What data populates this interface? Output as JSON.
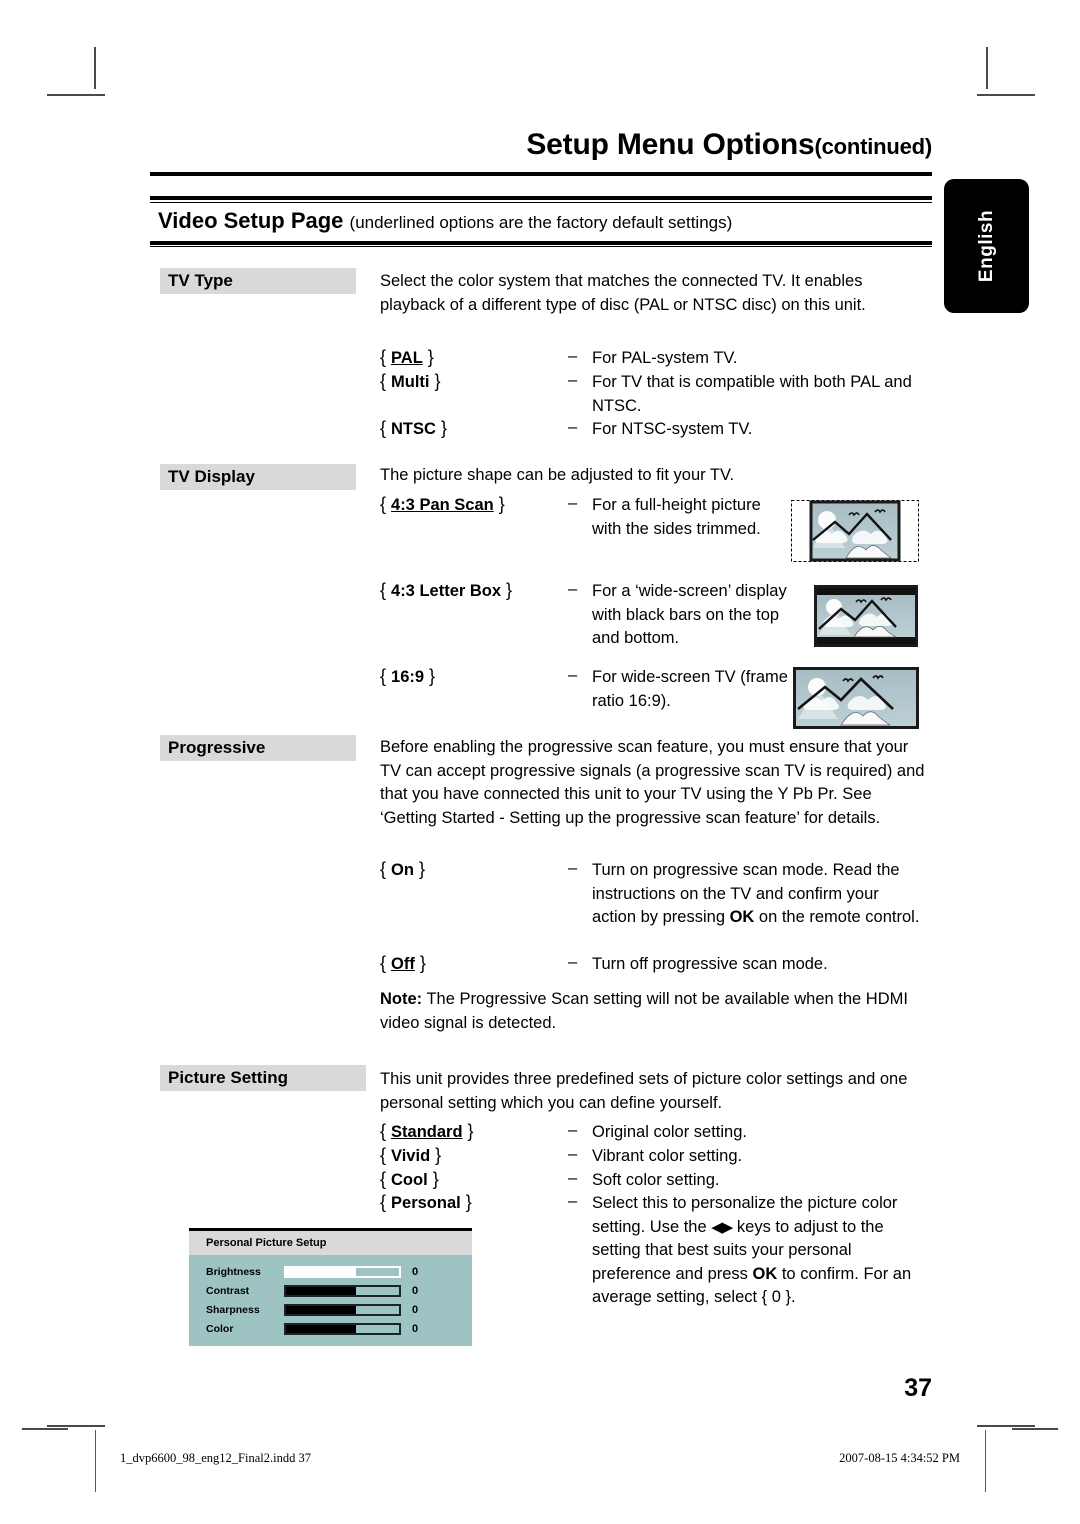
{
  "header": {
    "title": "Setup Menu Options",
    "title_suffix": "(continued)",
    "section_title": "Video Setup Page",
    "section_subtitle": "(underlined options are the factory default settings)",
    "language_tab": "English"
  },
  "sections": [
    {
      "label": "TV Type",
      "intro": "Select the color system that matches the connected TV. It enables playback of a different type of disc (PAL or NTSC disc) on this unit.",
      "options": [
        {
          "name": "PAL",
          "underlined": true,
          "dash": "–",
          "desc": "For PAL-system TV."
        },
        {
          "name": "Multi",
          "underlined": false,
          "dash": "–",
          "desc": "For TV that is compatible with both PAL and NTSC."
        },
        {
          "name": "NTSC",
          "underlined": false,
          "dash": "–",
          "desc": "For NTSC-system TV."
        }
      ]
    },
    {
      "label": "TV Display",
      "intro": "The picture shape can be adjusted to fit your TV.",
      "options": [
        {
          "name": "4:3 Pan Scan",
          "underlined": true,
          "dash": "–",
          "desc": "For a full-height picture with the sides trimmed.",
          "thumb": "pan-scan"
        },
        {
          "name": "4:3 Letter Box",
          "underlined": false,
          "dash": "–",
          "desc": "For a ‘wide-screen’ display with black bars on the top and bottom.",
          "thumb": "letter-box"
        },
        {
          "name": "16:9",
          "underlined": false,
          "dash": "–",
          "desc": "For wide-screen TV (frame ratio 16:9).",
          "thumb": "widescreen"
        }
      ]
    },
    {
      "label": "Progressive",
      "intro": "Before enabling the progressive scan feature, you must ensure that your TV can accept progressive signals (a progressive scan TV is required) and that you have connected this unit to your TV using the Y Pb Pr. See ‘Getting Started - Setting up the progressive scan feature’ for details.",
      "options": [
        {
          "name": "On",
          "underlined": false,
          "dash": "–",
          "desc_pre": "Turn on progressive scan mode. Read the instructions on the TV and confirm your action by pressing ",
          "desc_bold": "OK",
          "desc_post": " on the remote control."
        },
        {
          "name": "Off",
          "underlined": true,
          "dash": "–",
          "desc": "Turn off progressive scan mode."
        }
      ],
      "note_label": "Note:",
      "note_text": " The Progressive Scan setting will not be available when the HDMI video signal is detected."
    },
    {
      "label": "Picture Setting",
      "intro": "This unit provides three predefined sets of picture color settings and one personal setting which you can define yourself.",
      "options": [
        {
          "name": "Standard",
          "underlined": true,
          "dash": "–",
          "desc": "Original color setting."
        },
        {
          "name": "Vivid",
          "underlined": false,
          "dash": "–",
          "desc": "Vibrant color setting."
        },
        {
          "name": "Cool",
          "underlined": false,
          "dash": "–",
          "desc": "Soft color setting."
        },
        {
          "name": "Personal",
          "underlined": false,
          "dash": "–",
          "desc_pre": "Select this to personalize the picture color setting. Use the ",
          "desc_keys": "◀▶",
          "desc_mid": " keys to adjust to the setting that best suits your personal preference and press ",
          "desc_bold": "OK",
          "desc_post": " to confirm. For an average setting, select { 0 }."
        }
      ]
    }
  ],
  "osd": {
    "title": "Personal Picture Setup",
    "rows": [
      {
        "name": "Brightness",
        "value": "0",
        "fill_percent": 62,
        "style": "light"
      },
      {
        "name": "Contrast",
        "value": "0",
        "fill_percent": 62,
        "style": "dark"
      },
      {
        "name": "Sharpness",
        "value": "0",
        "fill_percent": 62,
        "style": "dark"
      },
      {
        "name": "Color",
        "value": "0",
        "fill_percent": 62,
        "style": "dark"
      }
    ],
    "colors": {
      "panel": "#9ec3c3",
      "title_bar": "#d9d9d9"
    }
  },
  "footer": {
    "page_number": "37",
    "file_name": "1_dvp6600_98_eng12_Final2.indd   37",
    "timestamp": "2007-08-15   4:34:52 PM"
  }
}
